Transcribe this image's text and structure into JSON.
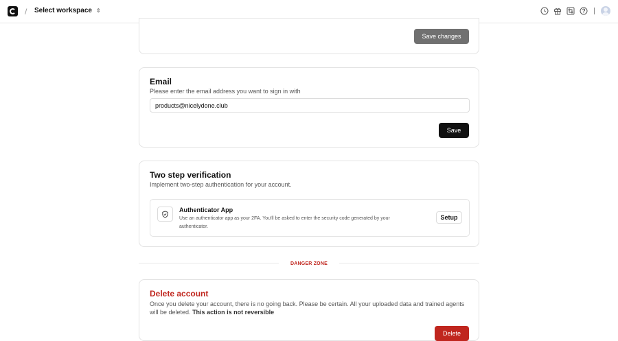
{
  "topbar": {
    "separator": "/",
    "workspace_label": "Select workspace",
    "workspace_chevron": "⇕",
    "icons": [
      "history-icon",
      "gift-icon",
      "git-compare-icon",
      "help-icon"
    ]
  },
  "profile_card": {
    "save_changes_label": "Save changes"
  },
  "email_card": {
    "title": "Email",
    "subtitle": "Please enter the email address you want to sign in with",
    "email_value": "products@nicelydone.club",
    "save_label": "Save"
  },
  "two_step_card": {
    "title": "Two step verification",
    "subtitle": "Implement two-step authentication for your account.",
    "auth_title": "Authenticator App",
    "auth_description": "Use an authenticator app as your 2FA. You'll be asked to enter the security code generated by your authenticator.",
    "setup_label": "Setup"
  },
  "danger_zone": {
    "label": "DANGER ZONE"
  },
  "delete_card": {
    "title": "Delete account",
    "description": "Once you delete your account, there is no going back. Please be certain. All your uploaded data and trained agents will be deleted.",
    "warning": "This action is not reversible",
    "delete_label": "Delete"
  },
  "colors": {
    "danger": "#c0261e",
    "primary": "#111111",
    "muted_button": "#707070"
  }
}
